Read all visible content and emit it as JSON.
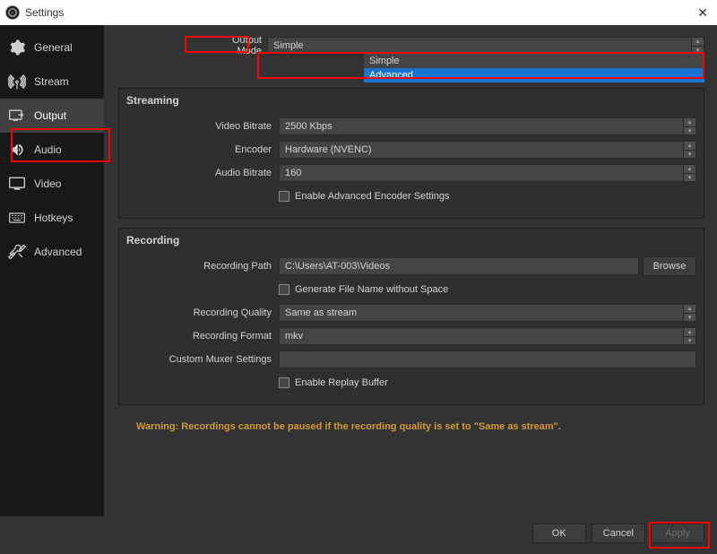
{
  "window": {
    "title": "Settings"
  },
  "sidebar": {
    "items": [
      {
        "label": "General"
      },
      {
        "label": "Stream"
      },
      {
        "label": "Output"
      },
      {
        "label": "Audio"
      },
      {
        "label": "Video"
      },
      {
        "label": "Hotkeys"
      },
      {
        "label": "Advanced"
      }
    ]
  },
  "output_mode": {
    "label": "Output Mode",
    "value": "Simple",
    "options": [
      "Simple",
      "Advanced"
    ]
  },
  "streaming": {
    "title": "Streaming",
    "video_bitrate": {
      "label": "Video Bitrate",
      "value": "2500 Kbps"
    },
    "encoder": {
      "label": "Encoder",
      "value": "Hardware (NVENC)"
    },
    "audio_bitrate": {
      "label": "Audio Bitrate",
      "value": "160"
    },
    "enable_adv": "Enable Advanced Encoder Settings"
  },
  "recording": {
    "title": "Recording",
    "path": {
      "label": "Recording Path",
      "value": "C:\\Users\\AT-003\\Videos",
      "browse": "Browse"
    },
    "no_space": "Generate File Name without Space",
    "quality": {
      "label": "Recording Quality",
      "value": "Same as stream"
    },
    "format": {
      "label": "Recording Format",
      "value": "mkv"
    },
    "muxer": {
      "label": "Custom Muxer Settings",
      "value": ""
    },
    "replay": "Enable Replay Buffer"
  },
  "warning": "Warning: Recordings cannot be paused if the recording quality is set to \"Same as stream\".",
  "footer": {
    "ok": "OK",
    "cancel": "Cancel",
    "apply": "Apply"
  }
}
